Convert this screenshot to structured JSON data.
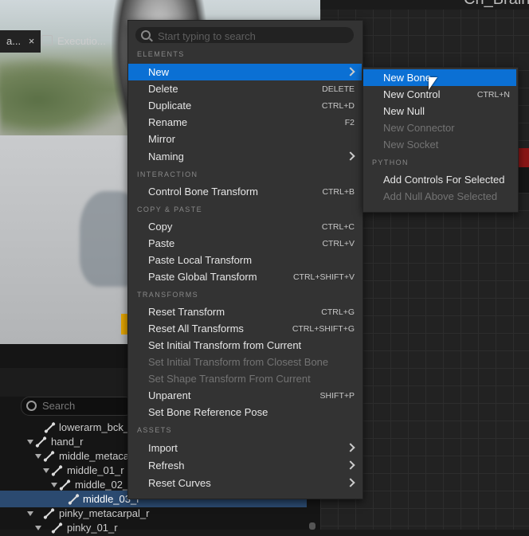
{
  "graph": {
    "title": "Ch_Brain"
  },
  "panel": {
    "tabs": [
      {
        "label": "a...",
        "close": "×"
      },
      {
        "label": "Executio..."
      }
    ],
    "search_placeholder": "Search",
    "tree": [
      {
        "label": "lowerarm_bck_"
      },
      {
        "label": "hand_r"
      },
      {
        "label": "middle_metaca"
      },
      {
        "label": "middle_01_r"
      },
      {
        "label": "middle_02_"
      },
      {
        "label": "middle_03_r"
      },
      {
        "label": "pinky_metacarpal_r"
      },
      {
        "label": "pinky_01_r"
      }
    ]
  },
  "menu": {
    "search_placeholder": "Start typing to search",
    "sections": {
      "elements": "ELEMENTS",
      "interaction": "INTERACTION",
      "copy_paste": "COPY & PASTE",
      "transforms": "TRANSFORMS",
      "assets": "ASSETS"
    },
    "items": {
      "new": {
        "label": "New"
      },
      "delete": {
        "label": "Delete",
        "shortcut": "DELETE"
      },
      "duplicate": {
        "label": "Duplicate",
        "shortcut": "CTRL+D"
      },
      "rename": {
        "label": "Rename",
        "shortcut": "F2"
      },
      "mirror": {
        "label": "Mirror"
      },
      "naming": {
        "label": "Naming"
      },
      "control_bone_transform": {
        "label": "Control Bone Transform",
        "shortcut": "CTRL+B"
      },
      "copy": {
        "label": "Copy",
        "shortcut": "CTRL+C"
      },
      "paste": {
        "label": "Paste",
        "shortcut": "CTRL+V"
      },
      "paste_local": {
        "label": "Paste Local Transform"
      },
      "paste_global": {
        "label": "Paste Global Transform",
        "shortcut": "CTRL+SHIFT+V"
      },
      "reset_transform": {
        "label": "Reset Transform",
        "shortcut": "CTRL+G"
      },
      "reset_all": {
        "label": "Reset All Transforms",
        "shortcut": "CTRL+SHIFT+G"
      },
      "set_initial": {
        "label": "Set Initial Transform from Current"
      },
      "set_initial_closest": {
        "label": "Set Initial Transform from Closest Bone"
      },
      "set_shape": {
        "label": "Set Shape Transform From Current"
      },
      "unparent": {
        "label": "Unparent",
        "shortcut": "SHIFT+P"
      },
      "set_bone_ref": {
        "label": "Set Bone Reference Pose"
      },
      "import": {
        "label": "Import"
      },
      "refresh": {
        "label": "Refresh"
      },
      "reset_curves": {
        "label": "Reset Curves"
      }
    }
  },
  "submenu": {
    "python_section": "PYTHON",
    "items": {
      "new_bone": {
        "label": "New Bone"
      },
      "new_control": {
        "label": "New Control",
        "shortcut": "CTRL+N"
      },
      "new_null": {
        "label": "New Null"
      },
      "new_connector": {
        "label": "New Connector"
      },
      "new_socket": {
        "label": "New Socket"
      },
      "add_controls": {
        "label": "Add Controls For Selected"
      },
      "add_null": {
        "label": "Add Null Above Selected"
      }
    }
  },
  "colors": {
    "highlight": "#0b70d4",
    "menu_bg": "#333333",
    "selection": "#2b4a70"
  }
}
